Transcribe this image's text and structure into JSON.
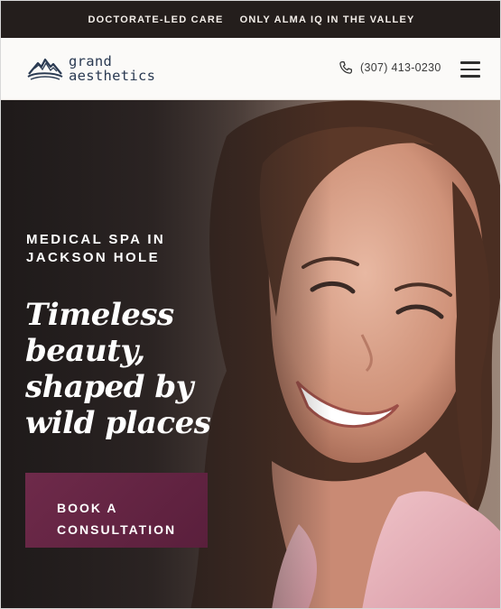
{
  "announcement_bar": {
    "items": [
      "DOCTORATE-LED CARE",
      "ONLY ALMA IQ IN THE VALLEY"
    ]
  },
  "header": {
    "logo": {
      "line1": "grand",
      "line2": "aesthetics",
      "icon": "mountain-logo-icon"
    },
    "phone": {
      "icon": "phone-icon",
      "number": "(307) 413-0230"
    },
    "menu": {
      "icon": "hamburger-menu-icon"
    }
  },
  "hero": {
    "eyebrow_line1": "MEDICAL SPA IN",
    "eyebrow_line2": "JACKSON HOLE",
    "headline_lines": [
      "Timeless",
      "beauty,",
      "shaped by",
      "wild places"
    ],
    "cta": {
      "line1": "BOOK A",
      "line2": "CONSULTATION"
    }
  },
  "colors": {
    "topbar_bg": "#241e1c",
    "logo_navy": "#2a3a52",
    "cta_plum": "#6e2a4a",
    "header_bg": "#fbfaf8"
  }
}
